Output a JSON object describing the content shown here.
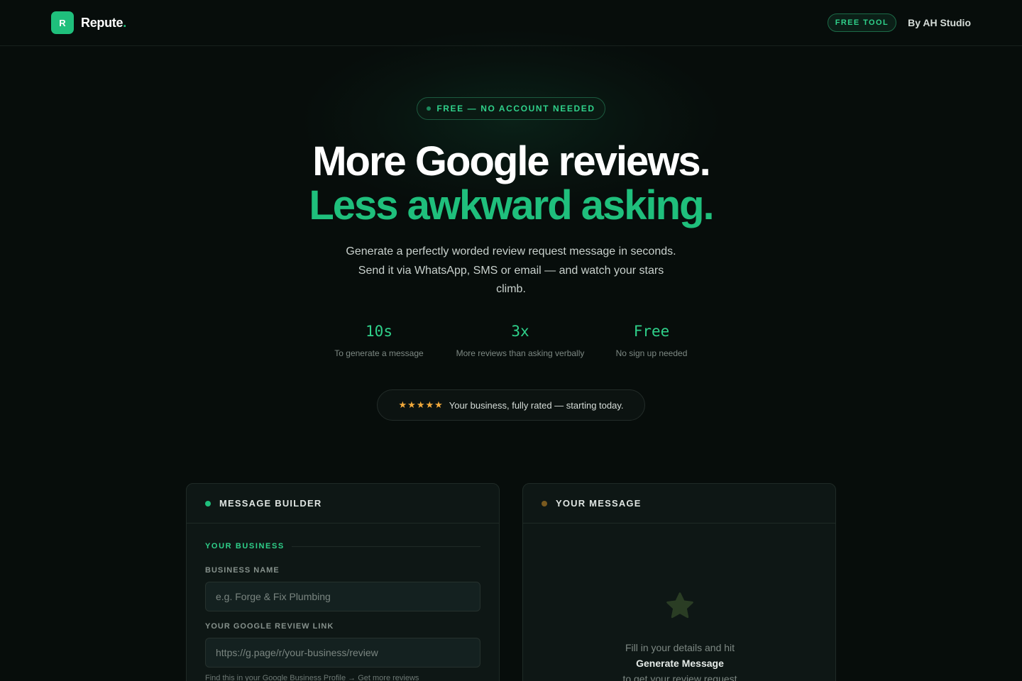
{
  "nav": {
    "logo_letter": "R",
    "brand": "Repute",
    "brand_dot": ".",
    "free_tool": "FREE TOOL",
    "by": "By AH Studio"
  },
  "hero": {
    "badge": "FREE — NO ACCOUNT NEEDED",
    "title_line1": "More Google reviews.",
    "title_line2": "Less awkward asking.",
    "subtitle_line1": "Generate a perfectly worded review request message in seconds.",
    "subtitle_line2": "Send it via WhatsApp, SMS or email — and watch your stars",
    "subtitle_line3": "climb.",
    "stats": [
      {
        "value": "10s",
        "label": "To generate a message"
      },
      {
        "value": "3x",
        "label": "More reviews than asking verbally"
      },
      {
        "value": "Free",
        "label": "No sign up needed"
      }
    ],
    "rating_stars": "★★★★★",
    "rating_text": "Your business, fully rated — starting today."
  },
  "builder": {
    "title": "MESSAGE BUILDER",
    "section": "YOUR BUSINESS",
    "business_name_label": "BUSINESS NAME",
    "business_name_placeholder": "e.g. Forge & Fix Plumbing",
    "review_link_label": "YOUR GOOGLE REVIEW LINK",
    "review_link_placeholder": "https://g.page/r/your-business/review",
    "hint": "Find this in your Google Business Profile → Get more reviews"
  },
  "message": {
    "title": "YOUR MESSAGE",
    "empty_line1": "Fill in your details and hit",
    "empty_strong": "Generate Message",
    "empty_line3": "to get your review request"
  },
  "colors": {
    "accent": "#1fbf7c",
    "background": "#070d0b",
    "star": "#f2a93b"
  }
}
